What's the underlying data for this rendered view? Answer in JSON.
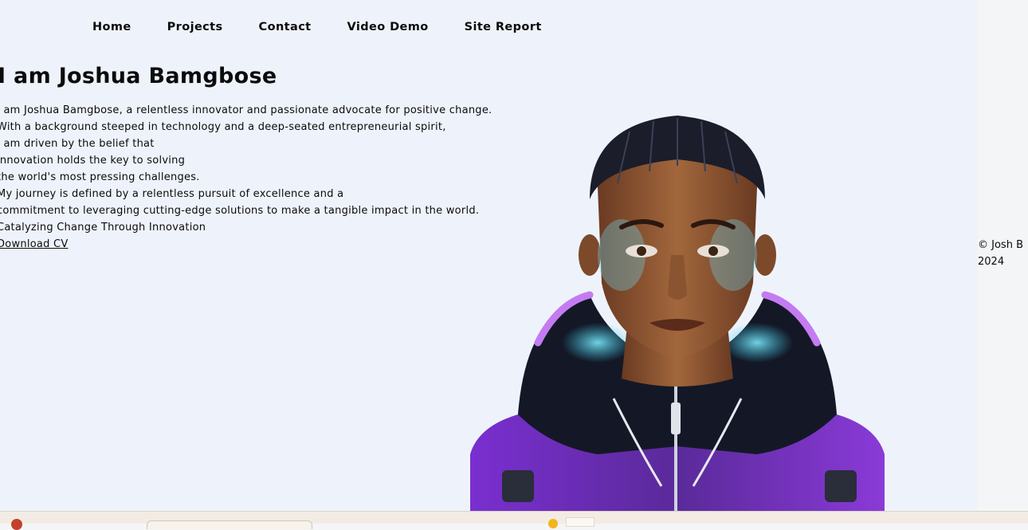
{
  "nav": {
    "items": [
      "Home",
      "Projects",
      "Contact",
      "Video Demo",
      "Site Report"
    ]
  },
  "hero": {
    "title": "I am Joshua Bamgbose",
    "bio_lines": [
      "I am Joshua Bamgbose, a relentless innovator and passionate advocate for positive change.",
      "With a background steeped in technology and a deep-seated entrepreneurial spirit,",
      "I am driven by the belief that",
      "innovation holds the key to solving",
      "the world's most pressing challenges.",
      "My journey is defined by a relentless pursuit of excellence and a",
      "commitment to leveraging cutting-edge solutions to make a tangible impact in the world.",
      "Catalyzing Change Through Innovation"
    ],
    "cv_link": "Download CV"
  },
  "footer": {
    "line1": "© Josh B",
    "line2": "2024"
  },
  "colors": {
    "page_bg": "#eef3fb",
    "text": "#0b0b0b",
    "hood_purple": "#7a2fd0",
    "hood_cyan": "#37c9e8",
    "skin": "#8a5430"
  },
  "icons": {
    "portrait": "portrait-illustration-icon"
  }
}
